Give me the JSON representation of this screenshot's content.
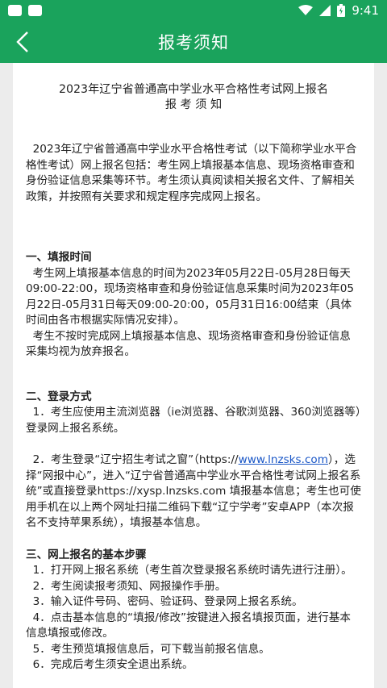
{
  "status_bar": {
    "time": "9:41"
  },
  "header": {
    "title": "报考须知"
  },
  "doc": {
    "title_line1": "2023年辽宁省普通高中学业水平合格性考试网上报名",
    "title_line2": "报 考 须 知",
    "intro": "  2023年辽宁省普通高中学业水平合格性考试（以下简称学业水平合格性考试）网上报名包括：考生网上填报基本信息、现场资格审查和身份验证信息采集等环节。考生须认真阅读相关报名文件、了解相关政策，并按照有关要求和规定程序完成网上报名。",
    "s1_title": "一、填报时间",
    "s1_p1": "  考生网上填报基本信息的时间为2023年05月22日-05月28日每天09:00-22:00，现场资格审查和身份验证信息采集时间为2023年05月22日-05月31日每天09:00-20:00，05月31日16:00结束（具体时间由各市根据实际情况安排）。",
    "s1_p2": "  考生不按时完成网上填报基本信息、现场资格审查和身份验证信息采集均视为放弃报名。",
    "s2_title": " 二、登录方式",
    "s2_p1": "  1．考生应使用主流浏览器（ie浏览器、谷歌浏览器、360浏览器等）登录网上报名系统。",
    "s2_p2_a": "  2．考生登录“辽宁招生考试之窗”（https://",
    "s2_link": "www.lnzsks.com",
    "s2_p2_b": "），选择“网报中心”，进入“辽宁省普通高中学业水平合格性考试网上报名系统”或直接登录https://xysp.lnzsks.com 填报基本信息；考生也可使用手机在以上两个网址扫描二维码下载“辽宁学考”安卓APP（本次报名不支持苹果系统），填报基本信息。",
    "s3_title": " 三、网上报名的基本步骤",
    "s3_steps": [
      "  1．打开网上报名系统（考生首次登录报名系统时请先进行注册）。",
      "  2．考生阅读报考须知、网报操作手册。",
      "  3．输入证件号码、密码、验证码、登录网上报名系统。",
      "  4．点击基本信息的“填报/修改”按键进入报名填报页面，进行基本信息填报或修改。",
      "  5．考生预览填报信息后，可下载当前报名信息。",
      "  6．完成后考生须安全退出系统。"
    ]
  }
}
